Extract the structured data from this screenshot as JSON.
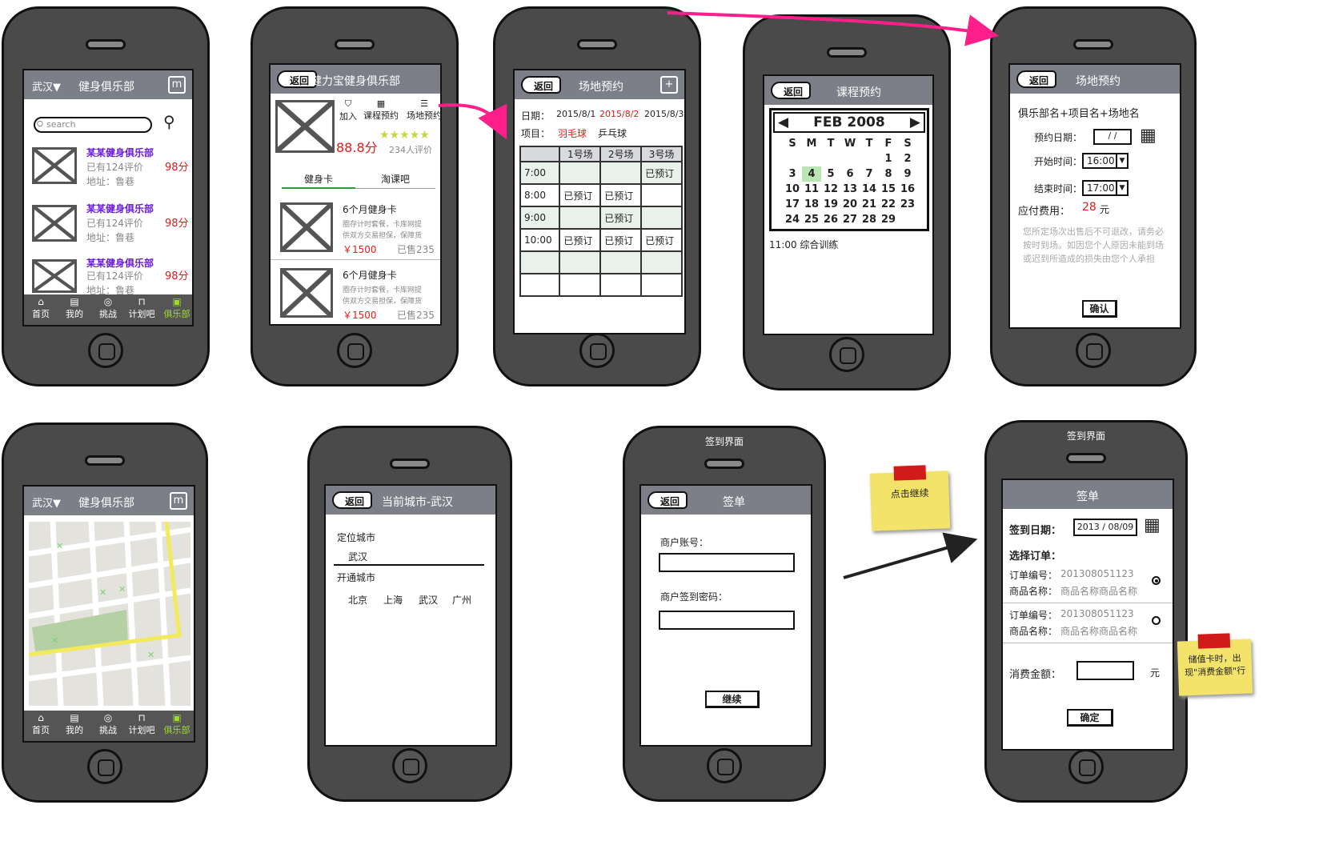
{
  "s1": {
    "city": "武汉▼",
    "title": "健身俱乐部",
    "search_placeholder": "search",
    "items": [
      {
        "name": "某某健身俱乐部",
        "reviews": "已有124评价",
        "address": "地址：鲁巷",
        "score": "98分"
      },
      {
        "name": "某某健身俱乐部",
        "reviews": "已有124评价",
        "address": "地址：鲁巷",
        "score": "98分"
      },
      {
        "name": "某某健身俱乐部",
        "reviews": "已有124评价",
        "address": "地址：鲁巷",
        "score": "98分"
      }
    ],
    "tabs": [
      "首页",
      "我的",
      "挑战",
      "计划吧",
      "俱乐部"
    ]
  },
  "s2": {
    "back": "返回",
    "title": "健力宝健身俱乐部",
    "actions": [
      "加入",
      "课程预约",
      "场地预约"
    ],
    "score": "88.8分",
    "review_count": "234人评价",
    "rating": 5,
    "seg_tabs": [
      "健身卡",
      "淘课吧"
    ],
    "cards": [
      {
        "title": "6个月健身卡",
        "desc1": "圈存计时套餐，卡库网提",
        "desc2": "供双方交易担保，保障货",
        "price": "￥1500",
        "sold": "已售235"
      },
      {
        "title": "6个月健身卡",
        "desc1": "圈存计时套餐，卡库网提",
        "desc2": "供双方交易担保，保障货",
        "price": "￥1500",
        "sold": "已售235"
      }
    ]
  },
  "s3": {
    "back": "返回",
    "title": "场地预约",
    "date_label": "日期：",
    "dates": [
      "2015/8/1",
      "2015/8/2",
      "2015/8/3"
    ],
    "sport_label": "项目：",
    "sports": [
      "羽毛球",
      "乒乓球"
    ],
    "columns": [
      "",
      "1号场",
      "2号场",
      "3号场"
    ],
    "rows": [
      [
        "7:00",
        "",
        "",
        "已预订"
      ],
      [
        "8:00",
        "已预订",
        "已预订",
        ""
      ],
      [
        "9:00",
        "",
        "已预订",
        ""
      ],
      [
        "10:00",
        "已预订",
        "已预订",
        "已预订"
      ],
      [
        "",
        "",
        "",
        ""
      ],
      [
        "",
        "",
        "",
        ""
      ]
    ]
  },
  "s4": {
    "back": "返回",
    "title": "课程预约",
    "month": "FEB 2008",
    "weekdays": [
      "S",
      "M",
      "T",
      "W",
      "T",
      "F",
      "S"
    ],
    "weeks": [
      [
        "",
        "",
        "",
        "",
        "",
        "1",
        "2"
      ],
      [
        "3",
        "4",
        "5",
        "6",
        "7",
        "8",
        "9"
      ],
      [
        "10",
        "11",
        "12",
        "13",
        "14",
        "15",
        "16"
      ],
      [
        "17",
        "18",
        "19",
        "20",
        "21",
        "22",
        "23"
      ],
      [
        "24",
        "25",
        "26",
        "27",
        "28",
        "29",
        ""
      ]
    ],
    "selected_day": "4",
    "course": "11:00 综合训练"
  },
  "s5": {
    "back": "返回",
    "title": "场地预约",
    "heading": "俱乐部名+项目名+场地名",
    "date_label": "预约日期：",
    "date_value": "/ /",
    "start_label": "开始时间：",
    "start_value": "16:00",
    "end_label": "结束时间：",
    "end_value": "17:00",
    "fee_label": "应付费用：",
    "fee_value": "28",
    "fee_unit": "元",
    "notice": "您所定场次出售后不可退改，请务必按时到场。如因您个人原因未能到场或迟到所造成的损失由您个人承担",
    "confirm": "确认"
  },
  "s6": {
    "city": "武汉▼",
    "title": "健身俱乐部",
    "tabs": [
      "首页",
      "我的",
      "挑战",
      "计划吧",
      "俱乐部"
    ]
  },
  "s7": {
    "back": "返回",
    "title": "当前城市-武汉",
    "located_label": "定位城市",
    "located_city": "武汉",
    "open_label": "开通城市",
    "cities": [
      "北京",
      "上海",
      "武汉",
      "广州"
    ]
  },
  "s8": {
    "caption": "签到界面",
    "back": "返回",
    "title": "签单",
    "account_label": "商户账号：",
    "password_label": "商户签到密码：",
    "continue": "继续"
  },
  "s9": {
    "caption": "签到界面",
    "title": "签单",
    "date_label": "签到日期：",
    "date_value": "2013 / 08/09",
    "select_label": "选择订单：",
    "orders": [
      {
        "no_label": "订单编号：",
        "no": "201308051123",
        "name_label": "商品名称：",
        "name": "商品名称商品名称",
        "selected": true
      },
      {
        "no_label": "订单编号：",
        "no": "201308051123",
        "name_label": "商品名称：",
        "name": "商品名称商品名称",
        "selected": false
      }
    ],
    "amount_label": "消费金额：",
    "amount_unit": "元",
    "confirm": "确定"
  },
  "notes": {
    "continue_note": "点击继续",
    "stored_card_note": "储值卡时，出现\"消费金额\"行"
  },
  "colors": {
    "nav": "#7c7f88",
    "accent_purple": "#6a1bd0",
    "red": "#e31b1b",
    "arrow_pink": "#ff1f8a",
    "tab_active": "#9ddc2a"
  }
}
